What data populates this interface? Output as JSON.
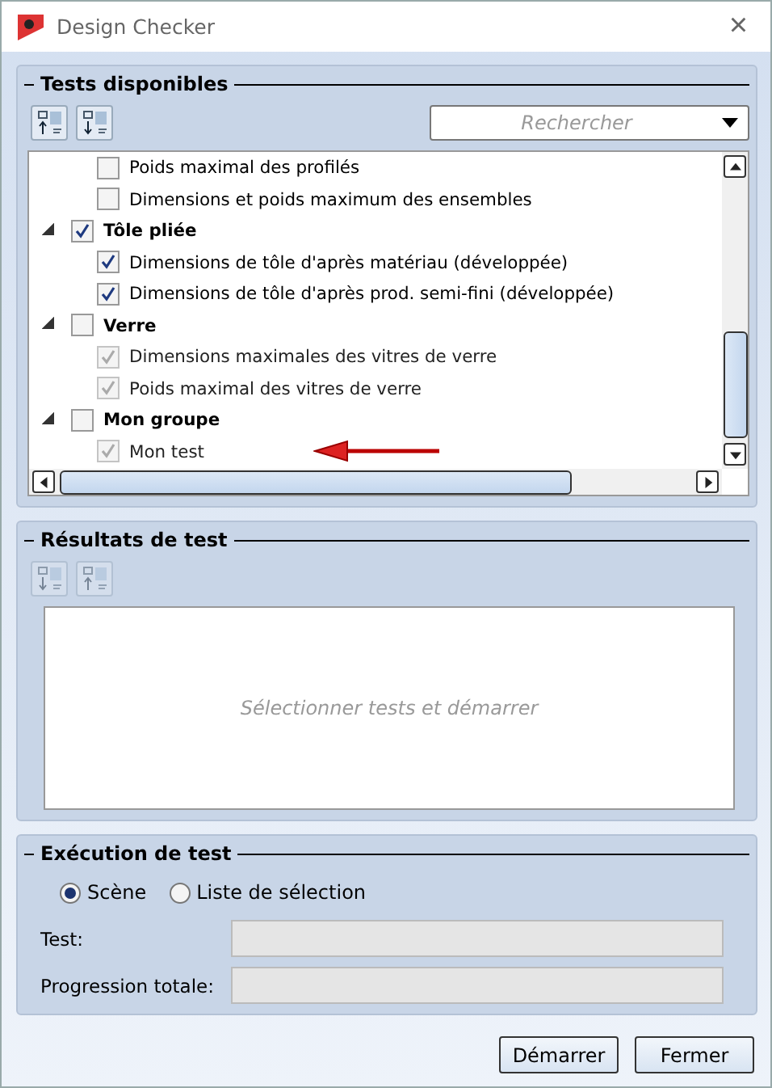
{
  "window": {
    "title": "Design Checker",
    "close": "×"
  },
  "available": {
    "title": "Tests disponibles",
    "search": {
      "placeholder": "Rechercher"
    },
    "items": [
      {
        "kind": "test",
        "label": "Poids maximal des profilés",
        "checked": false,
        "disabled": false
      },
      {
        "kind": "test",
        "label": "Dimensions et poids maximum des ensembles",
        "checked": false,
        "disabled": false
      },
      {
        "kind": "group",
        "label": "Tôle pliée",
        "checked": true,
        "expanded": true,
        "children": [
          {
            "kind": "test",
            "label": "Dimensions de tôle d'après matériau (développée)",
            "checked": true,
            "disabled": false
          },
          {
            "kind": "test",
            "label": "Dimensions de tôle d'après prod. semi-fini (développée)",
            "checked": true,
            "disabled": false
          }
        ]
      },
      {
        "kind": "group",
        "label": "Verre",
        "checked": false,
        "expanded": true,
        "children": [
          {
            "kind": "test",
            "label": "Dimensions maximales des vitres de verre",
            "checked": true,
            "disabled": true
          },
          {
            "kind": "test",
            "label": "Poids maximal des vitres de verre",
            "checked": true,
            "disabled": true
          }
        ]
      },
      {
        "kind": "group",
        "label": "Mon groupe",
        "checked": false,
        "expanded": true,
        "children": [
          {
            "kind": "test",
            "label": "Mon test",
            "checked": true,
            "disabled": true,
            "annotated": true
          }
        ]
      }
    ]
  },
  "results": {
    "title": "Résultats de test",
    "placeholder": "Sélectionner tests et démarrer"
  },
  "execution": {
    "title": "Exécution de test",
    "scope": [
      {
        "label": "Scène",
        "selected": true
      },
      {
        "label": "Liste de sélection",
        "selected": false
      }
    ],
    "fields": [
      {
        "label": "Test:"
      },
      {
        "label": "Progression totale:"
      }
    ]
  },
  "buttons": [
    "Démarrer",
    "Fermer"
  ]
}
